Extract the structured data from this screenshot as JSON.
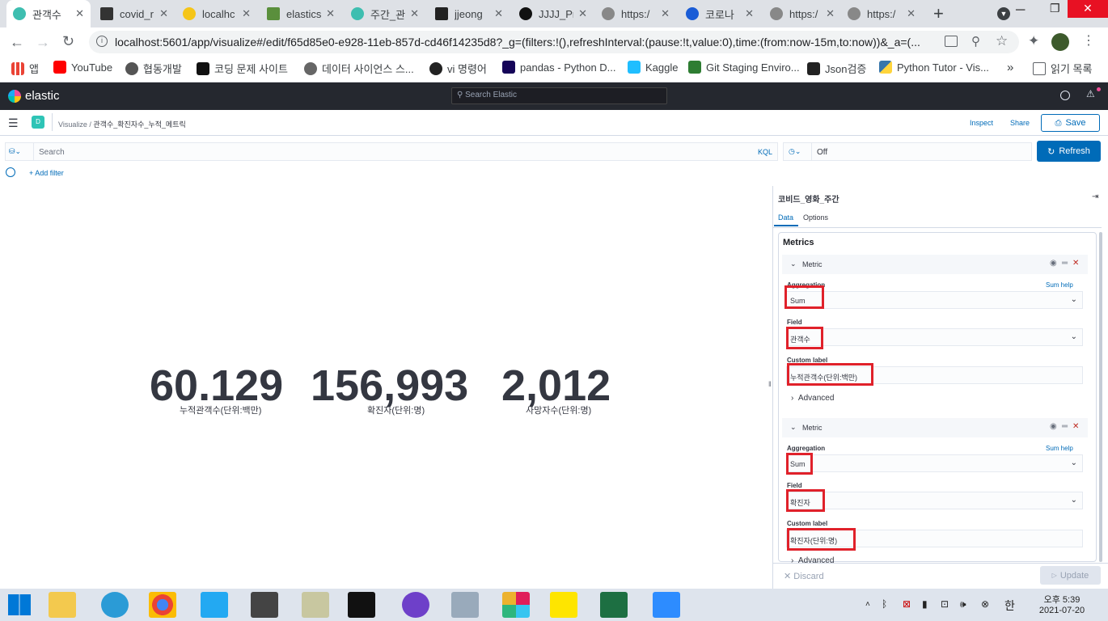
{
  "browser": {
    "tabs": [
      {
        "title": "관객수",
        "active": true
      },
      {
        "title": "covid_r"
      },
      {
        "title": "localhc"
      },
      {
        "title": "elastics"
      },
      {
        "title": "주간_관"
      },
      {
        "title": "jjeong"
      },
      {
        "title": "JJJJ_Prc"
      },
      {
        "title": "https:/"
      },
      {
        "title": "코로나"
      },
      {
        "title": "https:/"
      },
      {
        "title": "https:/"
      }
    ],
    "new_tab": "+",
    "url": "localhost:5601/app/visualize#/edit/f65d85e0-e928-11eb-857d-cd46f14235d8?_g=(filters:!(),refreshInterval:(pause:!t,value:0),time:(from:now-15m,to:now))&_a=(...",
    "bookmarks": [
      "앱",
      "YouTube",
      "협동개발",
      "코딩 문제 사이트",
      "데이터 사이언스 스...",
      "vi 명령어",
      "pandas - Python D...",
      "Kaggle",
      "Git Staging Enviro...",
      "Json검증",
      "Python Tutor - Vis..."
    ],
    "bookmarks_overflow": "»",
    "reading_list": "읽기 목록"
  },
  "kibana": {
    "logo": "elastic",
    "search_placeholder": "Search Elastic",
    "space_badge": "D",
    "breadcrumb": [
      "Visualize",
      "관객수_확진자수_누적_메트릭"
    ],
    "actions": {
      "inspect": "Inspect",
      "share": "Share",
      "save": "Save"
    },
    "query": {
      "placeholder": "Search",
      "language": "KQL",
      "time": "Off",
      "refresh": "Refresh",
      "add_filter": "+ Add filter"
    },
    "metrics": [
      {
        "value": "60.129",
        "label": "누적관객수(단위:백만)"
      },
      {
        "value": "156,993",
        "label": "확진자(단위:명)"
      },
      {
        "value": "2,012",
        "label": "사망자수(단위:명)"
      }
    ],
    "panel": {
      "title": "코비드_영화_주간",
      "tabs": [
        "Data",
        "Options"
      ],
      "section": "Metrics",
      "metric_items": [
        {
          "header": "Metric",
          "agg_label": "Aggregation",
          "help": "Sum help",
          "aggregation": "Sum",
          "field_label": "Field",
          "field": "관객수",
          "custom_label_label": "Custom label",
          "custom_label": "누적관객수(단위:백만)",
          "advanced": "Advanced"
        },
        {
          "header": "Metric",
          "agg_label": "Aggregation",
          "help": "Sum help",
          "aggregation": "Sum",
          "field_label": "Field",
          "field": "확진자",
          "custom_label_label": "Custom label",
          "custom_label": "확진자(단위:명)",
          "advanced": "Advanced"
        }
      ],
      "discard": "Discard",
      "update": "Update"
    }
  },
  "taskbar": {
    "clock_time": "오후 5:39",
    "clock_date": "2021-07-20",
    "ime": "한"
  }
}
